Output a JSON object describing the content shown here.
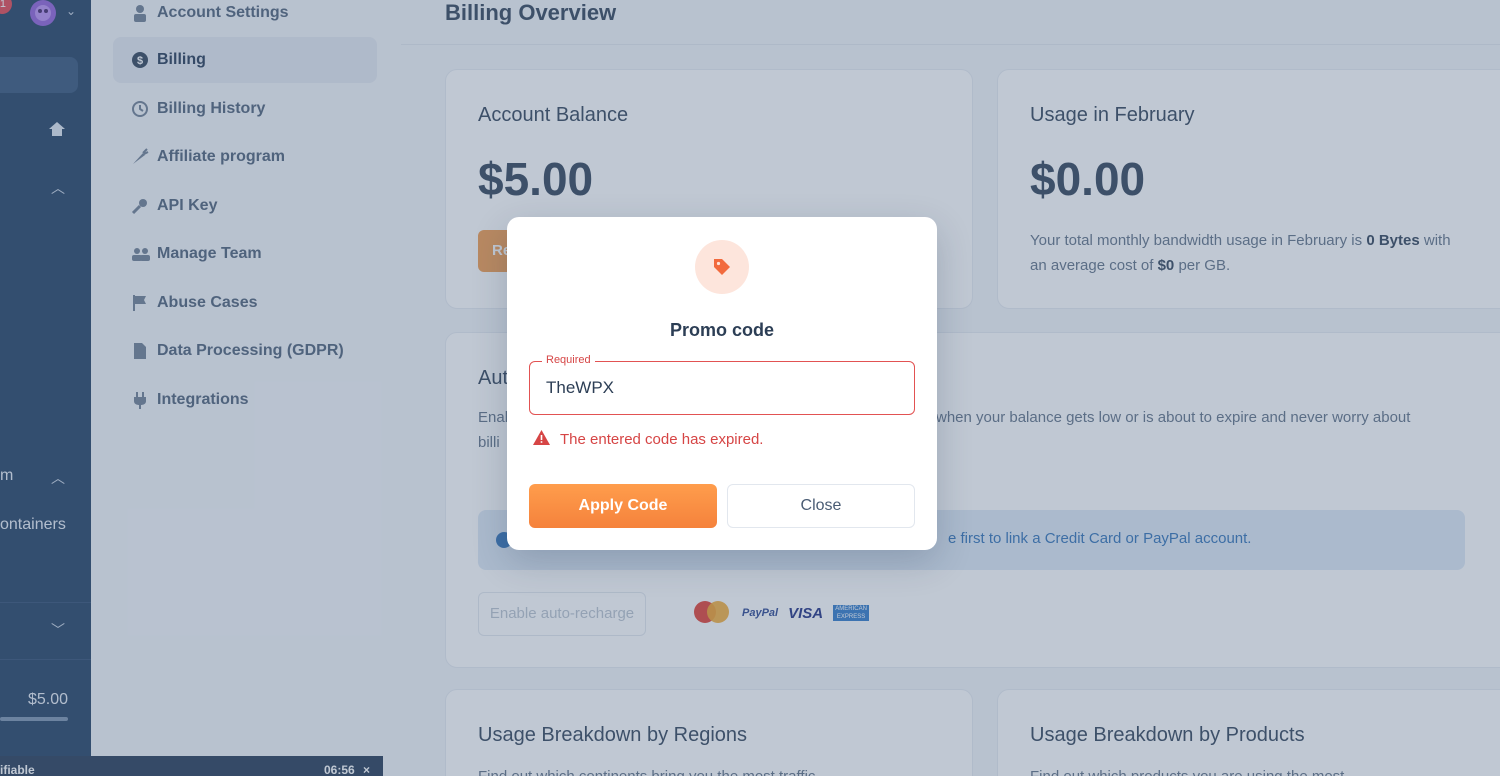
{
  "rail": {
    "notification_count": "1",
    "text_m": "m",
    "text_containers": "ontainers",
    "balance": "$5.00"
  },
  "timer": {
    "left_text": "ifiable",
    "time": "06:56",
    "close_symbol": "×"
  },
  "menu": {
    "items": [
      {
        "label": "Account Settings",
        "icon": "user-icon"
      },
      {
        "label": "Billing",
        "icon": "dollar-icon"
      },
      {
        "label": "Billing History",
        "icon": "history-icon"
      },
      {
        "label": "Affiliate program",
        "icon": "carrot-icon"
      },
      {
        "label": "API Key",
        "icon": "key-icon"
      },
      {
        "label": "Manage Team",
        "icon": "team-icon"
      },
      {
        "label": "Abuse Cases",
        "icon": "flag-icon"
      },
      {
        "label": "Data Processing (GDPR)",
        "icon": "document-icon"
      },
      {
        "label": "Integrations",
        "icon": "plug-icon"
      }
    ]
  },
  "main": {
    "page_title": "Billing Overview",
    "balance_card": {
      "title": "Account Balance",
      "amount": "$5.00",
      "button_stub": "Re"
    },
    "usage_card": {
      "title": "Usage in February",
      "amount": "$0.00",
      "desc_1": "Your total monthly bandwidth usage in February is ",
      "desc_bold_1": "0 Bytes",
      "desc_2": " with",
      "desc_3": "an average cost of ",
      "desc_bold_2": "$0",
      "desc_4": " per GB."
    },
    "auto_card": {
      "title_stub": "Aut",
      "desc_left_1": "Enal",
      "desc_left_2": "billi",
      "desc_right": "when your balance gets low or is about to expire and never worry about",
      "info_text": "e first to link a Credit Card or PayPal account.",
      "enable_button": "Enable auto-recharge",
      "payment_logos": {
        "mastercard": "mastercard",
        "paypal": "PayPal",
        "visa": "VISA",
        "amex": "AMERICAN EXPRESS"
      }
    },
    "regions_card": {
      "title": "Usage Breakdown by Regions",
      "desc": "Find out which continents bring you the most traffic"
    },
    "products_card": {
      "title": "Usage Breakdown by Products",
      "desc": "Find out which products you are using the most"
    }
  },
  "modal": {
    "title": "Promo code",
    "field_legend": "Required",
    "field_value": "TheWPX",
    "error": "The entered code has expired.",
    "apply_label": "Apply Code",
    "close_label": "Close"
  },
  "colors": {
    "accent": "#f5823c",
    "error": "#d64545",
    "rail": "#1c3a5e"
  }
}
